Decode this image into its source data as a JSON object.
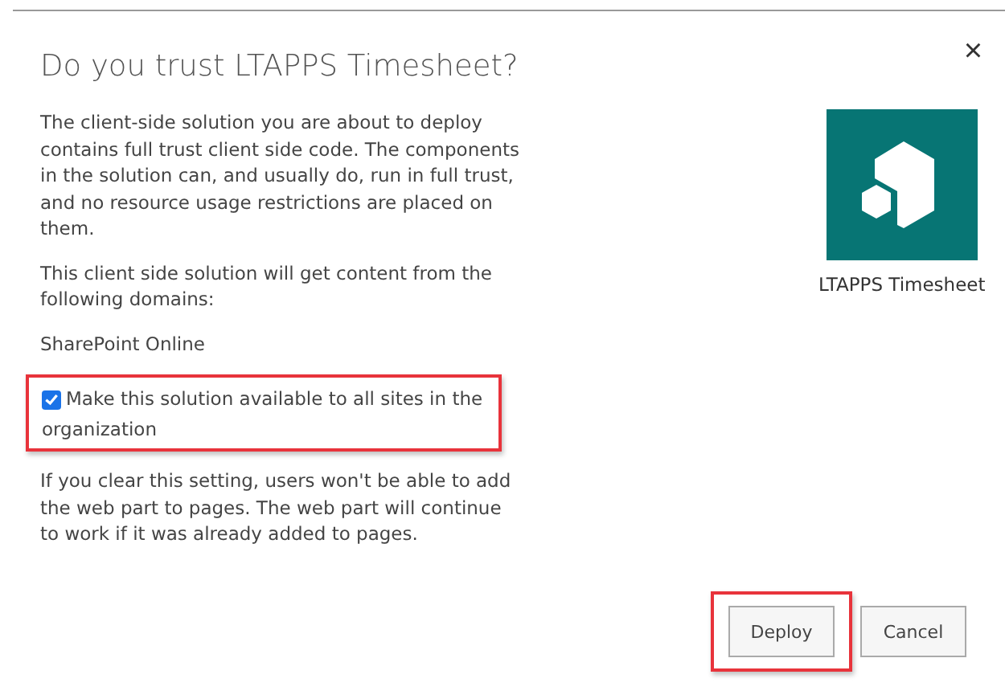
{
  "dialog": {
    "title": "Do you trust LTAPPS Timesheet?",
    "close": "×"
  },
  "intro": "The client-side solution you are about to deploy contains full trust client side code. The components in the solution can, and usually do, run in full trust, and no resource usage restrictions are placed on them.",
  "domains_text": "This client side solution will get content from the following domains:",
  "domains": [
    "SharePoint Online"
  ],
  "option": {
    "label": "Make this solution available to all sites in the organization",
    "checked": true,
    "highlighted": true
  },
  "note": "If you clear this setting, users won't be able to add the web part to pages. The web part will continue to work if it was already added to pages.",
  "app": {
    "name": "LTAPPS Timesheet"
  },
  "buttons": [
    {
      "label": "Deploy",
      "highlighted": true
    },
    {
      "label": "Cancel",
      "highlighted": false
    }
  ]
}
